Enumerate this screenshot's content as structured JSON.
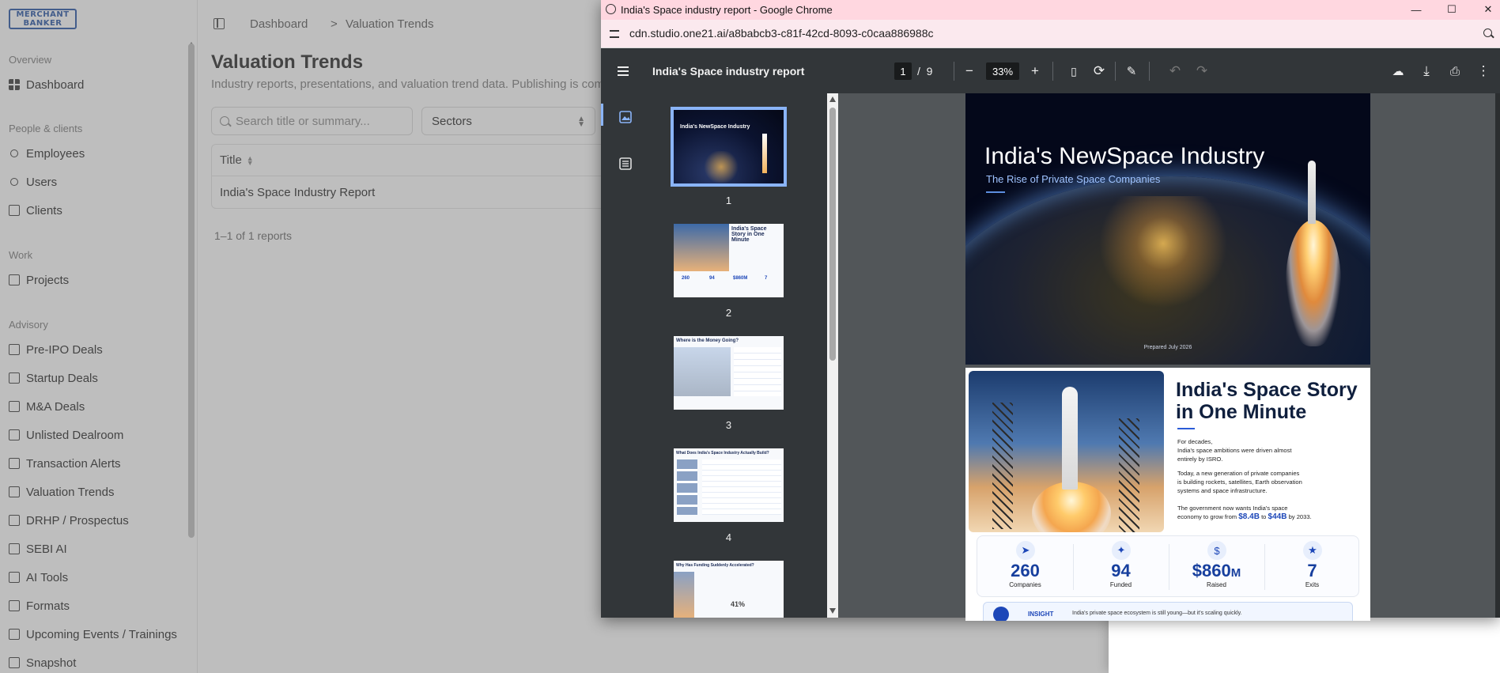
{
  "app": {
    "logo_line1": "MERCHANT",
    "logo_line2": "BANKER",
    "sections": [
      "Overview",
      "People & clients",
      "Work",
      "Advisory"
    ],
    "nav": {
      "dashboard": "Dashboard",
      "employees": "Employees",
      "users": "Users",
      "clients": "Clients",
      "projects": "Projects",
      "pre_ipo": "Pre-IPO Deals",
      "startup": "Startup Deals",
      "ma": "M&A Deals",
      "unlisted": "Unlisted Dealroom",
      "alerts": "Transaction Alerts",
      "valuation": "Valuation Trends",
      "drhp": "DRHP / Prospectus",
      "sebi": "SEBI AI",
      "ai_tools": "AI Tools",
      "formats": "Formats",
      "events": "Upcoming Events / Trainings",
      "snapshot": "Snapshot"
    },
    "breadcrumb": [
      "Dashboard",
      ">",
      "Valuation Trends"
    ],
    "page_title": "Valuation Trends",
    "page_subtitle": "Industry reports, presentations, and valuation trend data. Publishing is comin",
    "search_placeholder": "Search title or summary...",
    "sectors_label": "Sectors",
    "table_header": "Title",
    "table_rows": [
      "India's Space Industry Report"
    ],
    "count_text": "1–1 of 1 reports"
  },
  "chrome": {
    "window_title": "India's Space industry report - Google Chrome",
    "url": "cdn.studio.one21.ai/a8babcb3-c81f-42cd-8093-c0caa886988c",
    "pdf": {
      "doc_title": "India's Space industry report",
      "current_page": "1",
      "page_sep": "/",
      "page_total": "9",
      "zoom": "33%",
      "thumb_numbers": [
        "1",
        "2",
        "3",
        "4"
      ],
      "thumb_texts": {
        "t1_title": "India's NewSpace Industry",
        "t2_title": "India's Space Story in One Minute",
        "t3_title": "Where is the Money Going?",
        "t4_title": "What Does India's Space Industry Actually Build?",
        "t5_title": "Why Has Funding Suddenly Accelerated?",
        "t2_stats": [
          "260",
          "94",
          "$860M",
          "7"
        ],
        "t5_percent": "41%"
      }
    },
    "page1": {
      "title": "India's NewSpace Industry",
      "subtitle": "The Rise of Private Space Companies",
      "date": "Prepared July 2026"
    },
    "page2": {
      "title_line1": "India's Space Story",
      "title_line2": "in One Minute",
      "p1_line1": "For decades,",
      "p1_line2": "India's space ambitions were driven almost",
      "p1_line3": "entirely by ISRO.",
      "p2_line1": "Today, a new generation of private companies",
      "p2_line2": "is building rockets, satellites, Earth observation",
      "p2_line3": "systems and space infrastructure.",
      "p3_line1": "The government now wants India's space",
      "p3_line2_pre": "economy to grow from",
      "p3_from": "$8.4B",
      "p3_to_word": "to",
      "p3_to": "$44B",
      "p3_by": "by 2033.",
      "stats": [
        {
          "value": "260",
          "label": "Companies",
          "icon": "rocket-icon"
        },
        {
          "value": "94",
          "label": "Funded",
          "icon": "satellite-icon"
        },
        {
          "value": "$860",
          "unit": "M",
          "label": "Raised",
          "icon": "money-bag-icon"
        },
        {
          "value": "7",
          "label": "Exits",
          "icon": "trophy-icon"
        }
      ],
      "insight_label": "INSIGHT",
      "insight_text": "India's private space ecosystem is still young—but it's scaling quickly."
    }
  }
}
